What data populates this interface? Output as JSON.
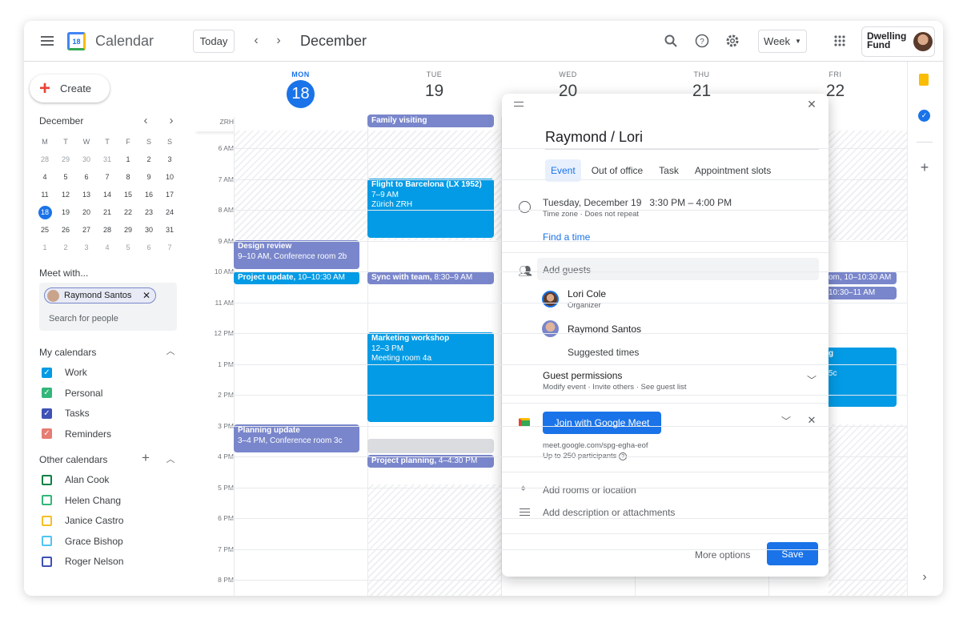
{
  "header": {
    "app_title": "Calendar",
    "logo_day": "18",
    "today_label": "Today",
    "month": "December",
    "view_label": "Week",
    "brand": "Dwelling Fund",
    "icons": [
      "menu-icon",
      "chevron-left-icon",
      "chevron-right-icon",
      "search-icon",
      "help-icon",
      "settings-icon",
      "apps-icon"
    ]
  },
  "sidebar": {
    "create_label": "Create",
    "mini": {
      "month": "December",
      "weekdays": [
        "M",
        "T",
        "W",
        "T",
        "F",
        "S",
        "S"
      ],
      "weeks": [
        [
          "28",
          "29",
          "30",
          "31",
          "1",
          "2",
          "3"
        ],
        [
          "4",
          "5",
          "6",
          "7",
          "8",
          "9",
          "10"
        ],
        [
          "11",
          "12",
          "13",
          "14",
          "15",
          "16",
          "17"
        ],
        [
          "18",
          "19",
          "20",
          "21",
          "22",
          "23",
          "24"
        ],
        [
          "25",
          "26",
          "27",
          "28",
          "29",
          "30",
          "31"
        ],
        [
          "1",
          "2",
          "3",
          "4",
          "5",
          "6",
          "7"
        ]
      ],
      "selected": "18"
    },
    "meet_with": "Meet with...",
    "person_chip": "Raymond Santos",
    "search_placeholder": "Search for people",
    "my_calendars_title": "My calendars",
    "my_calendars": [
      {
        "label": "Work",
        "color": "#039be5",
        "checked": true
      },
      {
        "label": "Personal",
        "color": "#33b679",
        "checked": true
      },
      {
        "label": "Tasks",
        "color": "#3f51b5",
        "checked": true
      },
      {
        "label": "Reminders",
        "color": "#e67c73",
        "checked": true
      }
    ],
    "other_calendars_title": "Other calendars",
    "other_calendars": [
      {
        "label": "Alan Cook",
        "color": "#0b8043",
        "checked": false
      },
      {
        "label": "Helen Chang",
        "color": "#33b679",
        "checked": false
      },
      {
        "label": "Janice Castro",
        "color": "#f6bf26",
        "checked": false
      },
      {
        "label": "Grace Bishop",
        "color": "#4fc3f7",
        "checked": false
      },
      {
        "label": "Roger Nelson",
        "color": "#3f51b5",
        "checked": false
      }
    ]
  },
  "grid": {
    "timezone": "ZRH",
    "days": [
      {
        "name": "MON",
        "num": "18",
        "today": true
      },
      {
        "name": "TUE",
        "num": "19"
      },
      {
        "name": "WED",
        "num": "20"
      },
      {
        "name": "THU",
        "num": "21"
      },
      {
        "name": "FRI",
        "num": "22"
      }
    ],
    "hours": [
      "6 AM",
      "7 AM",
      "8 AM",
      "9 AM",
      "10 AM",
      "11 AM",
      "12 PM",
      "1 PM",
      "2 PM",
      "3 PM",
      "4 PM",
      "5 PM",
      "6 PM",
      "7 PM",
      "8 PM"
    ],
    "events": {
      "family": "Family visiting",
      "flight": {
        "title": "Flight to Barcelona (LX 1952)",
        "time": "7–9 AM",
        "place": "Zürich ZRH"
      },
      "design": {
        "title": "Design review",
        "sub": "9–10 AM, Conference room 2b"
      },
      "project_update": {
        "title": "Project update,",
        "time": "10–10:30 AM"
      },
      "sync": {
        "title": "Sync with team,",
        "time": "8:30–9 AM"
      },
      "marketing": {
        "title": "Marketing workshop",
        "time": "12–3 PM",
        "place": "Meeting room 4a"
      },
      "planning": {
        "title": "Planning update",
        "sub": "3–4 PM, Conference room 3c"
      },
      "project_planning": {
        "title": "Project planning,",
        "time": "4–4:30 PM"
      },
      "fri1": "om, 10–10:30 AM",
      "fri2": "10:30–11 AM",
      "fri3a": "g",
      "fri3b": "5c"
    }
  },
  "popup": {
    "title": "Raymond / Lori",
    "tabs": [
      "Event",
      "Out of office",
      "Task",
      "Appointment slots"
    ],
    "active_tab": "Event",
    "date": "Tuesday, December 19",
    "time": "3:30 PM – 4:00 PM",
    "time_sub": "Time zone · Does not repeat",
    "find_time": "Find a time",
    "guests_placeholder": "Add guests",
    "guests": [
      {
        "name": "Lori Cole",
        "role": "Organizer"
      },
      {
        "name": "Raymond Santos"
      }
    ],
    "suggested": "Suggested times",
    "perm_title": "Guest permissions",
    "perm_sub": "Modify event · Invite others · See guest list",
    "meet_button": "Join with Google Meet",
    "meet_link": "meet.google.com/spg-egha-eof",
    "meet_sub": "Up to 250 participants",
    "location": "Add rooms or location",
    "description": "Add description or attachments",
    "more_options": "More options",
    "save": "Save"
  },
  "colors": {
    "accent": "#1a73e8",
    "event_blue": "#039be5",
    "event_purple": "#7986cb"
  }
}
